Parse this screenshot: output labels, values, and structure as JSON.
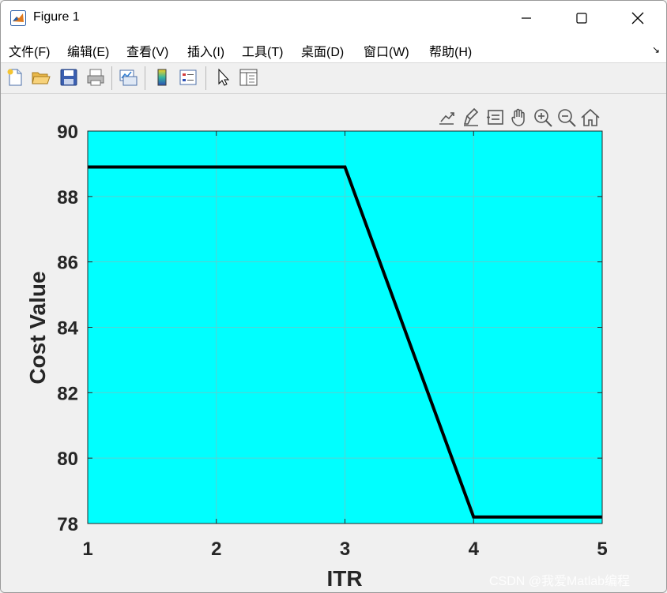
{
  "window": {
    "title": "Figure 1",
    "icons": {
      "app": "matlab-logo-icon",
      "minimize": "minimize-icon",
      "maximize": "maximize-icon",
      "close": "close-icon"
    }
  },
  "menu": {
    "items": [
      "文件(F)",
      "编辑(E)",
      "查看(V)",
      "插入(I)",
      "工具(T)",
      "桌面(D)",
      "窗口(W)",
      "帮助(H)"
    ],
    "corner_icon": "dock-arrow-icon"
  },
  "toolbar": {
    "icons": [
      "new-figure-icon",
      "open-file-icon",
      "save-icon",
      "print-icon",
      "link-plot-icon",
      "insert-colorbar-icon",
      "insert-legend-icon",
      "edit-plot-icon",
      "property-inspector-icon"
    ]
  },
  "axes_toolbar": {
    "icons": [
      "export-icon",
      "brush-icon",
      "data-tips-icon",
      "pan-icon",
      "zoom-in-icon",
      "zoom-out-icon",
      "home-icon"
    ]
  },
  "chart_data": {
    "type": "line",
    "x": [
      1,
      2,
      3,
      4,
      5
    ],
    "series": [
      {
        "values": [
          88.9,
          88.9,
          88.9,
          78.2,
          78.2
        ],
        "color": "#000000"
      }
    ],
    "xlabel": "ITR",
    "ylabel": "Cost Value",
    "xlim": [
      1,
      5
    ],
    "ylim": [
      78,
      90
    ],
    "xticks": [
      1,
      2,
      3,
      4,
      5
    ],
    "yticks": [
      78,
      80,
      82,
      84,
      86,
      88,
      90
    ],
    "grid": true,
    "background": "#00ffff"
  },
  "watermark": "CSDN @我爱Matlab编程"
}
